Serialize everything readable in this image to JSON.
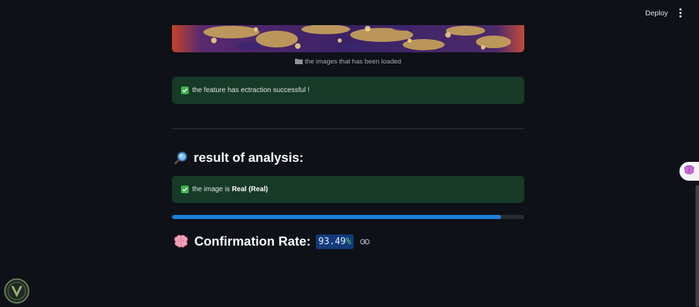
{
  "header": {
    "deploy_label": "Deploy",
    "menu_icon": "kebab-menu-icon"
  },
  "image": {
    "caption": "the images that has been loaded",
    "caption_icon": "folder-icon"
  },
  "feature_alert": {
    "icon": "check-icon",
    "text": "the feature has ectraction successful !"
  },
  "analysis": {
    "icon": "magnifier-icon",
    "title": "result of analysis:"
  },
  "result_alert": {
    "icon": "check-icon",
    "prefix": "the image is ",
    "value": "Real (Real)"
  },
  "progress": {
    "percent": 93.49,
    "color": "#1f7ed8"
  },
  "confirmation": {
    "icon": "brain-icon",
    "label": "Confirmation Rate:",
    "value_number": "93.49",
    "value_suffix": "%",
    "link_icon": "link-icon"
  },
  "side_tab": {
    "icon": "brain-icon"
  },
  "colors": {
    "background": "#0e1117",
    "success_bg": "#173928",
    "metric_bg": "#123a7a"
  }
}
